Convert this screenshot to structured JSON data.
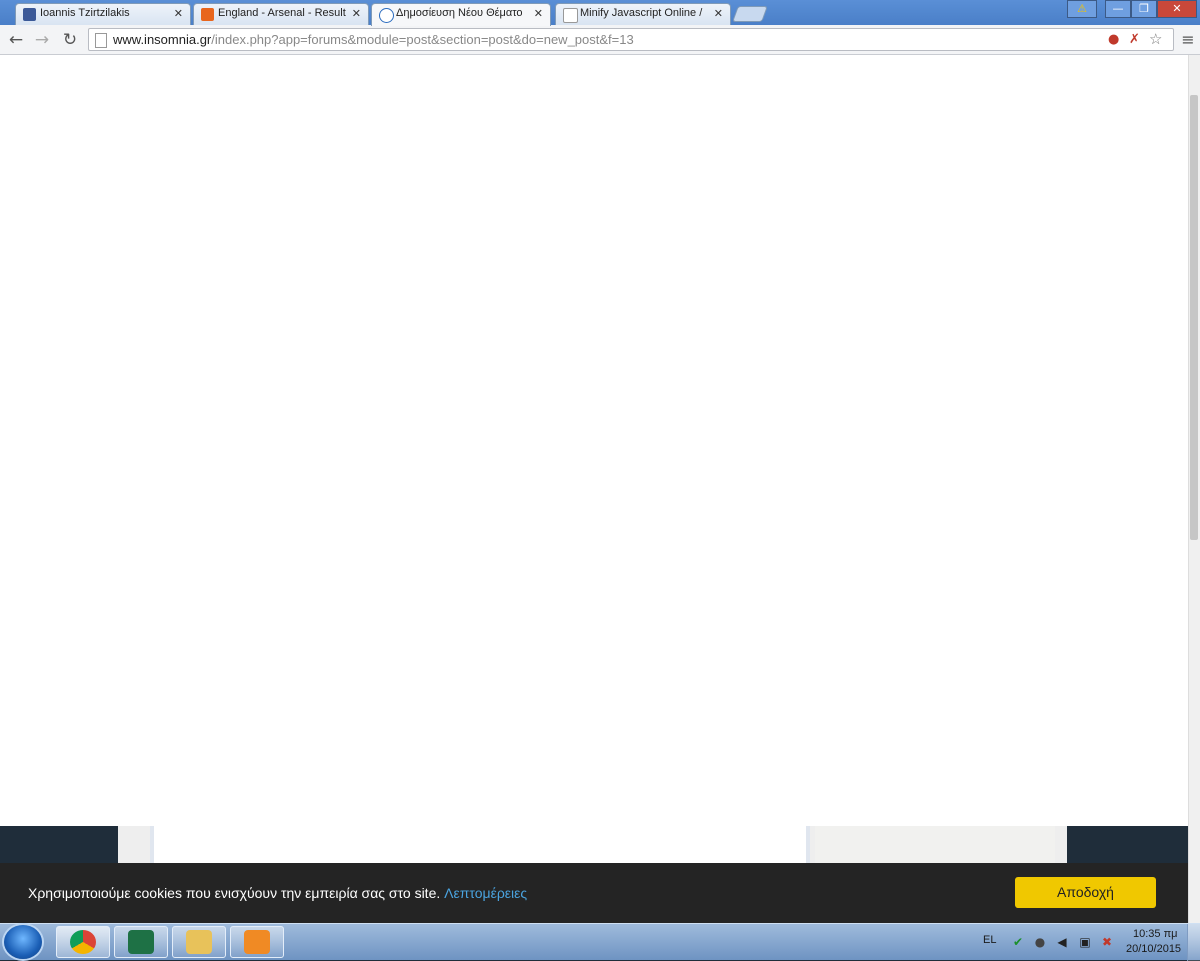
{
  "browser": {
    "tabs": [
      {
        "title": "Ioannis Tzirtzilakis",
        "icon": "facebook-icon",
        "color": "#3b5998"
      },
      {
        "title": "England - Arsenal - Result",
        "icon": "scores-site-icon",
        "color": "#e8661d"
      },
      {
        "title": "Δημοσίευση Νέου Θέματο",
        "icon": "insomnia-icon",
        "color": "#2a6bbf"
      },
      {
        "title": "Minify Javascript Online /",
        "icon": "page-icon",
        "color": "#cccccc"
      }
    ],
    "active_tab": 2,
    "url": {
      "host": "www.insomnia.gr",
      "path": "/index.php?app=forums&module=post&section=post&do=new_post&f=13"
    }
  },
  "cookie_bar": {
    "message": "Χρησιμοποιούμε cookies που ενισχύουν την εμπειρία σας στο site.",
    "details_link": "Λεπτομέρειες",
    "accept_label": "Αποδοχή",
    "accept_color": "#f0c800"
  },
  "taskbar": {
    "language": "EL",
    "time": "10:35 πμ",
    "date": "20/10/2015",
    "apps": [
      "chrome",
      "excel",
      "file-explorer",
      "media-player"
    ]
  }
}
